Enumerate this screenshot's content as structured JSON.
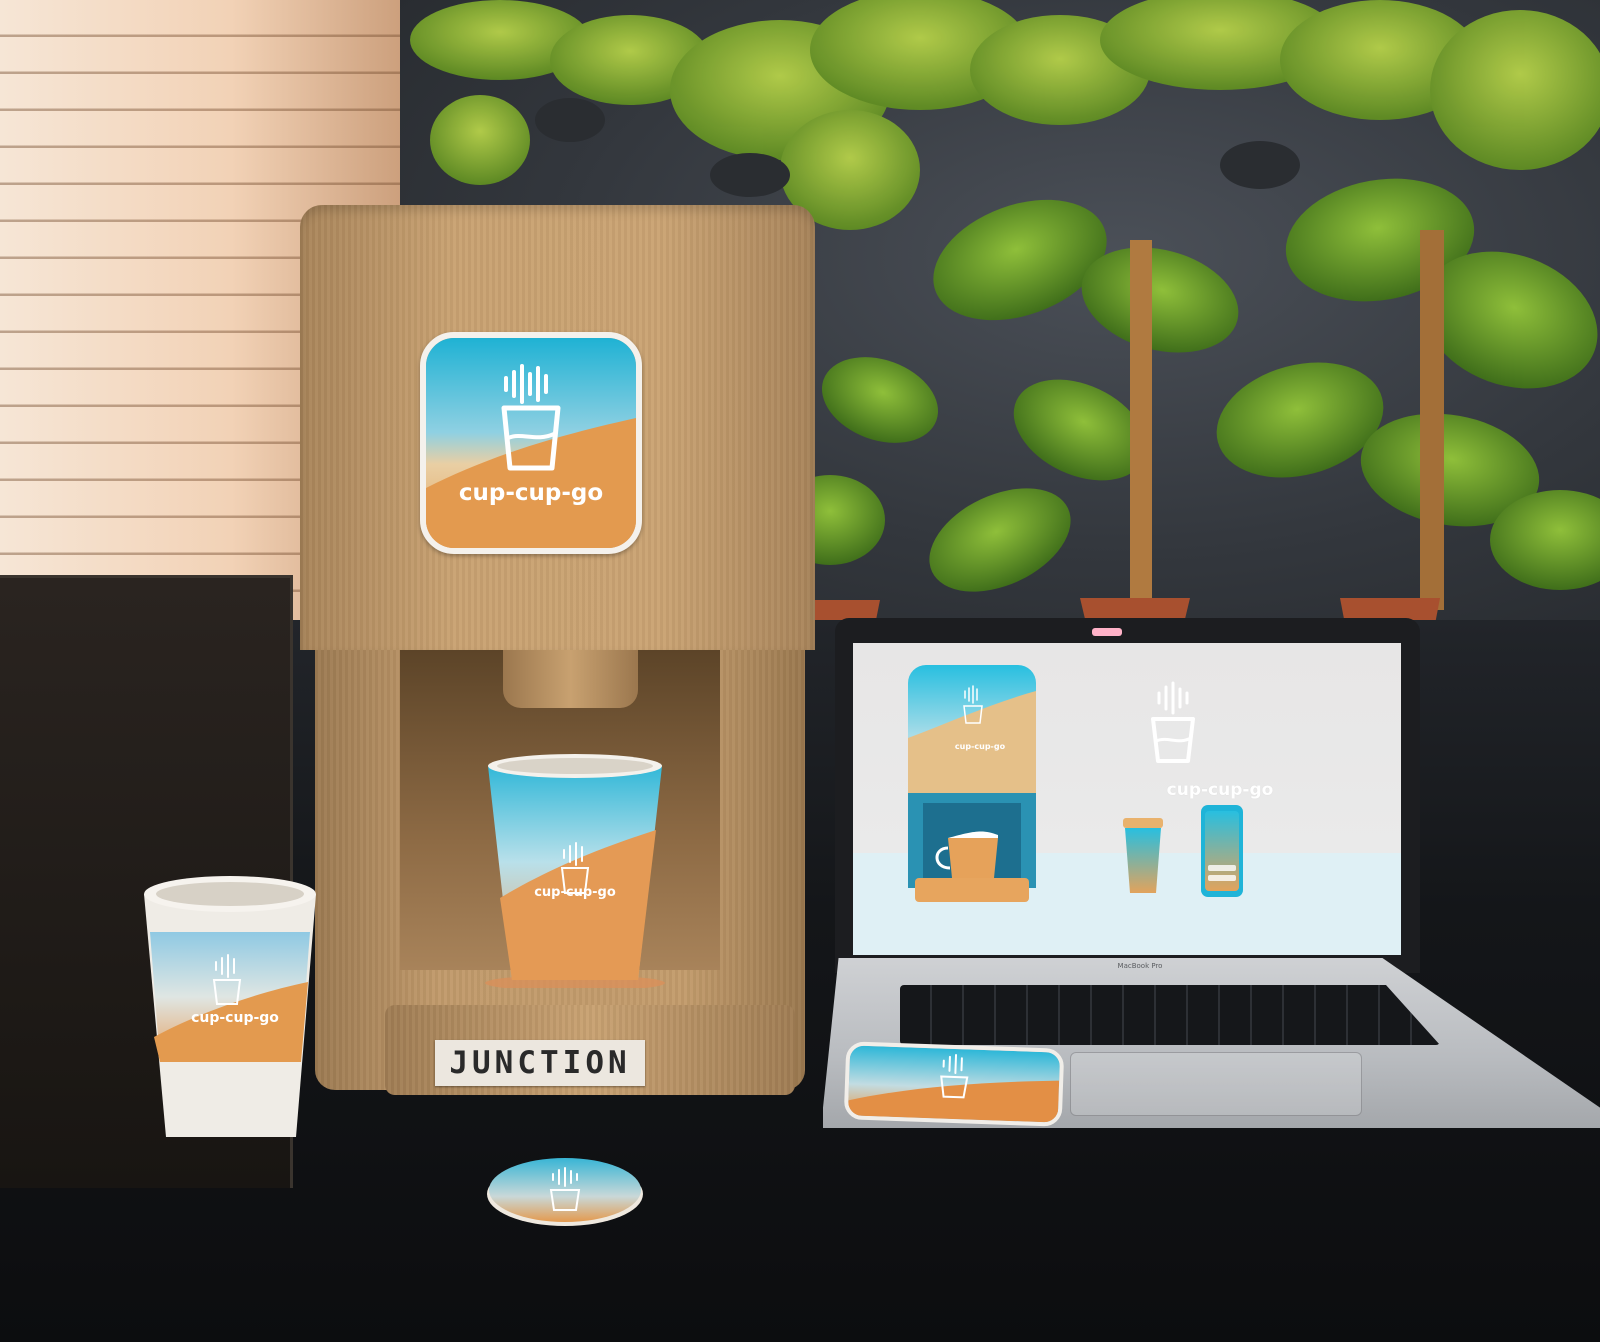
{
  "brand": {
    "name": "cup-cup-go",
    "colors": {
      "teal": "#2bb8d6",
      "sky": "#9fd6e6",
      "sand": "#e8c79a",
      "orange": "#e39a4f"
    },
    "logo_icon": "cup-soundwave-icon"
  },
  "machine": {
    "label": "JUNCTION",
    "material": "cardboard"
  },
  "laptop": {
    "model_label": "MacBook Pro",
    "screen": {
      "brand_text": "cup-cup-go",
      "machine_brand_text": "cup-cup-go"
    }
  },
  "cups": {
    "machine_cup_text": "cup-cup-go",
    "reusable_cup_text": "cup-cup-go"
  }
}
